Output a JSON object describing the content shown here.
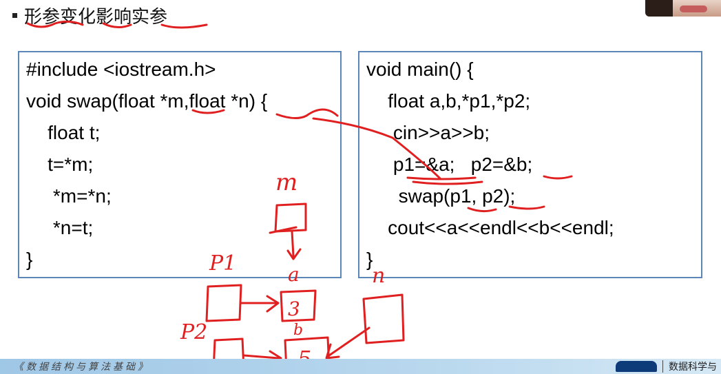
{
  "slide": {
    "title": "形参变化影响实参"
  },
  "code_left": {
    "lines": [
      "#include <iostream.h>",
      "void swap(float *m,float *n) {",
      "    float t;",
      "    t=*m;",
      "     *m=*n;",
      "     *n=t;",
      "}"
    ]
  },
  "code_right": {
    "lines": [
      "void main() {",
      "    float a,b,*p1,*p2;",
      "     cin>>a>>b;",
      "     p1=&a;   p2=&b;",
      "      swap(p1, p2);",
      "    cout<<a<<endl<<b<<endl;",
      "}"
    ]
  },
  "annotations": {
    "m": "m",
    "a": "a",
    "b": "b",
    "p1": "P1",
    "p2": "P2",
    "n": "n",
    "val_a": "3",
    "val_b": "5"
  },
  "footer": {
    "left_text": "《数据结构与算法基础》",
    "right_text": "数据科学与"
  },
  "colors": {
    "box_border": "#5b86b8",
    "ink_red": "#e02020",
    "footer_bg": "#b9d8ee"
  }
}
